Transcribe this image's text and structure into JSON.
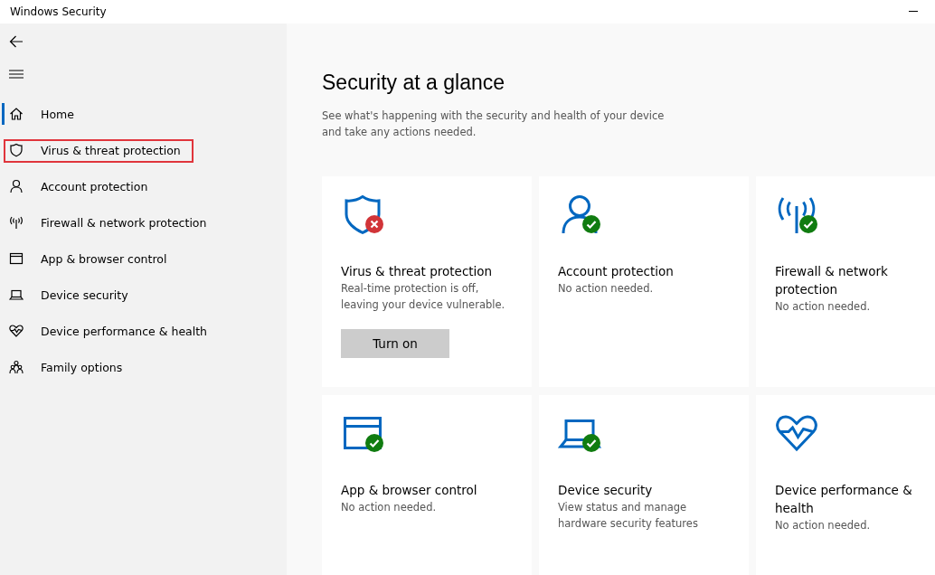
{
  "window": {
    "title": "Windows Security"
  },
  "sidebar": {
    "items": [
      {
        "label": "Home",
        "selected": true,
        "highlighted": false
      },
      {
        "label": "Virus & threat protection",
        "selected": false,
        "highlighted": true
      },
      {
        "label": "Account protection",
        "selected": false,
        "highlighted": false
      },
      {
        "label": "Firewall & network protection",
        "selected": false,
        "highlighted": false
      },
      {
        "label": "App & browser control",
        "selected": false,
        "highlighted": false
      },
      {
        "label": "Device security",
        "selected": false,
        "highlighted": false
      },
      {
        "label": "Device performance & health",
        "selected": false,
        "highlighted": false
      },
      {
        "label": "Family options",
        "selected": false,
        "highlighted": false
      }
    ]
  },
  "main": {
    "heading": "Security at a glance",
    "description": "See what's happening with the security and health of your device and take any actions needed.",
    "cards": [
      {
        "kind": "error",
        "title": "Virus & threat protection",
        "description": "Real-time protection is off, leaving your device vulnerable.",
        "button": "Turn on"
      },
      {
        "kind": "ok",
        "title": "Account protection",
        "description": "No action needed."
      },
      {
        "kind": "ok",
        "title": "Firewall & network protection",
        "description": "No action needed."
      },
      {
        "kind": "ok",
        "title": "App & browser control",
        "description": "No action needed."
      },
      {
        "kind": "ok",
        "title": "Device security",
        "description": "View status and manage hardware security features"
      },
      {
        "kind": "plain",
        "title": "Device performance & health",
        "description": "No action needed."
      }
    ]
  }
}
